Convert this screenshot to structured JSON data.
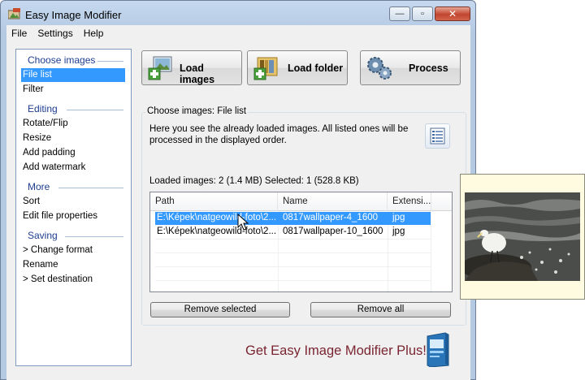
{
  "window": {
    "title": "Easy Image Modifier",
    "minimize_glyph": "—",
    "maximize_glyph": "▫",
    "close_glyph": "✕"
  },
  "menu": [
    "File",
    "Settings",
    "Help"
  ],
  "sidebar": {
    "sections": [
      {
        "title": "Choose images",
        "items": [
          "File list",
          "Filter"
        ]
      },
      {
        "title": "Editing",
        "items": [
          "Rotate/Flip",
          "Resize",
          "Add padding",
          "Add watermark"
        ]
      },
      {
        "title": "More",
        "items": [
          "Sort",
          "Edit file properties"
        ]
      },
      {
        "title": "Saving",
        "items": [
          "> Change format",
          "Rename",
          "> Set destination"
        ]
      }
    ],
    "active_item": "File list"
  },
  "toolbar": {
    "load_images": "Load images",
    "load_folder": "Load folder",
    "process": "Process"
  },
  "panel": {
    "group_title": "Choose images: File list",
    "description": "Here you see the already loaded images. All listed ones will be processed in the displayed order.",
    "stats": "Loaded images: 2 (1.4 MB)   Selected: 1 (528.8 KB)"
  },
  "file_list": {
    "columns": [
      "Path",
      "Name",
      "Extensi..."
    ],
    "rows": [
      {
        "path": "E:\\Képek\\natgeowild-foto\\2...",
        "name": "0817wallpaper-4_1600",
        "ext": "jpg",
        "selected": true
      },
      {
        "path": "E:\\Képek\\natgeowild-foto\\2...",
        "name": "0817wallpaper-10_1600",
        "ext": "jpg",
        "selected": false
      }
    ]
  },
  "buttons": {
    "remove_selected": "Remove selected",
    "remove_all": "Remove all"
  },
  "promo": "Get Easy Image Modifier Plus!",
  "colors": {
    "selection": "#3399ff",
    "sidebar_heading": "#1e3d8f",
    "promo": "#7a2531",
    "preview_bg": "#fffbe0"
  }
}
